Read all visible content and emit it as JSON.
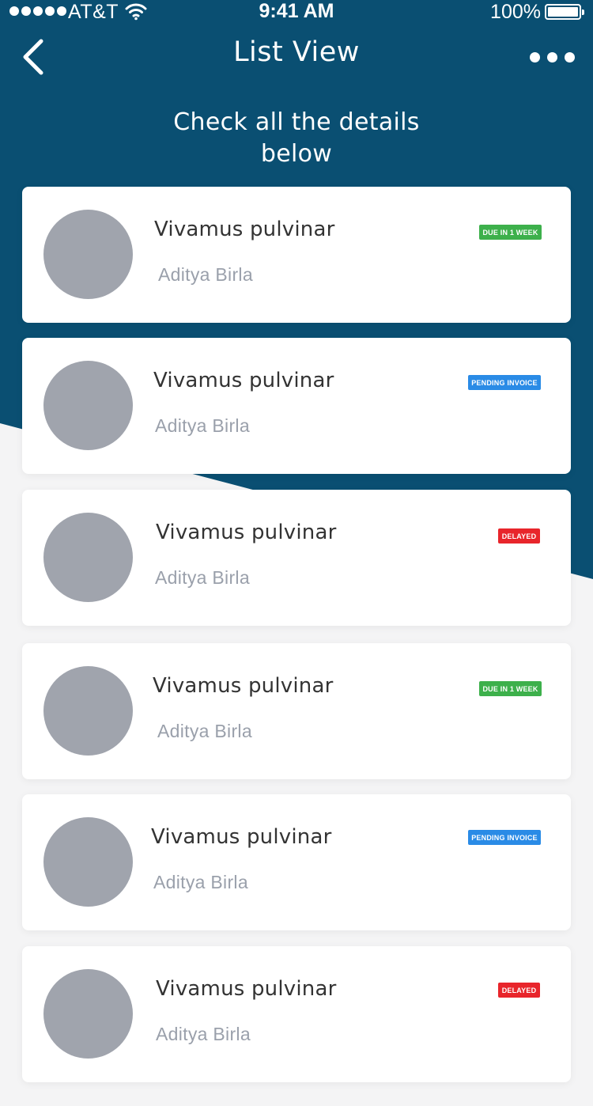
{
  "status_bar": {
    "carrier": "AT&T",
    "time": "9:41 AM",
    "battery": "100%",
    "battery_level": 1.0,
    "signal_bars": 5
  },
  "header": {
    "title": "List View",
    "subtitle_line1": "Check all the details",
    "subtitle_line2": "below",
    "back_icon": "chevron-left-icon",
    "more_icon": "more-horizontal-icon"
  },
  "colors": {
    "header_bg": "#0a4f72",
    "page_bg": "#f4f4f5",
    "avatar": "#a0a4ad",
    "badge_green": "#3db04b",
    "badge_blue": "#2a8be6",
    "badge_red": "#e8252b"
  },
  "items": [
    {
      "title": "Vivamus pulvinar",
      "subtitle": "Aditya Birla",
      "status": "DUE IN 1 WEEK",
      "status_color": "green"
    },
    {
      "title": "Vivamus pulvinar",
      "subtitle": "Aditya Birla",
      "status": "PENDING INVOICE",
      "status_color": "blue"
    },
    {
      "title": "Vivamus pulvinar",
      "subtitle": "Aditya Birla",
      "status": "DELAYED",
      "status_color": "red"
    },
    {
      "title": "Vivamus pulvinar",
      "subtitle": "Aditya Birla",
      "status": "DUE IN 1 WEEK",
      "status_color": "green"
    },
    {
      "title": "Vivamus pulvinar",
      "subtitle": "Aditya Birla",
      "status": "PENDING INVOICE",
      "status_color": "blue"
    },
    {
      "title": "Vivamus pulvinar",
      "subtitle": "Aditya Birla",
      "status": "DELAYED",
      "status_color": "red"
    }
  ]
}
